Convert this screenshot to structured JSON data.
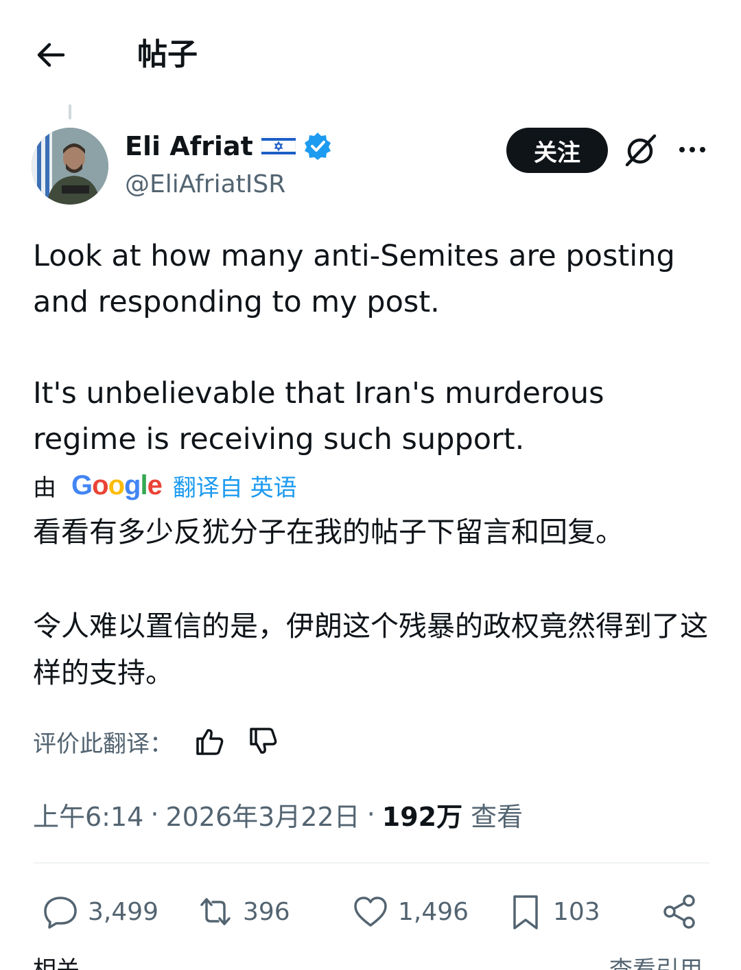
{
  "header": {
    "title": "帖子",
    "back_icon": "arrow-left-icon"
  },
  "author": {
    "display_name": "Eli Afriat",
    "flag_icon": "israel-flag-icon",
    "verified_icon": "verified-badge-icon",
    "handle": "@EliAfriatISR",
    "follow_label": "关注",
    "grok_icon": "grok-icon",
    "more_icon": "more-horizontal-icon"
  },
  "tweet": {
    "paragraph_1": "Look at how many anti-Semites are posting and responding to my post.",
    "paragraph_2": "It's unbelievable that Iran's murderous regime is receiving such support."
  },
  "translation": {
    "by_label": "由",
    "provider": "Google",
    "translated_from": "翻译自 英语",
    "paragraph_1": "看看有多少反犹分子在我的帖子下留言和回复。",
    "paragraph_2": "令人难以置信的是，伊朗这个残暴的政权竟然得到了这样的支持。",
    "rate_label": "评价此翻译：",
    "thumbs_up_icon": "thumbs-up-icon",
    "thumbs_down_icon": "thumbs-down-icon"
  },
  "meta": {
    "time": "上午6:14",
    "date": "2026年3月22日",
    "separator": "·",
    "views_count": "192万",
    "views_label": "查看"
  },
  "actions": {
    "replies": "3,499",
    "reposts": "396",
    "likes": "1,496",
    "bookmarks": "103",
    "reply_icon": "reply-icon",
    "repost_icon": "repost-icon",
    "like_icon": "heart-icon",
    "bookmark_icon": "bookmark-icon",
    "share_icon": "share-icon"
  },
  "footer": {
    "related_label": "相关",
    "view_quotes_label": "查看引用"
  },
  "colors": {
    "text_primary": "#0f1419",
    "text_secondary": "#536471",
    "accent_blue": "#1d9bf0",
    "divider": "#eff3f4"
  }
}
